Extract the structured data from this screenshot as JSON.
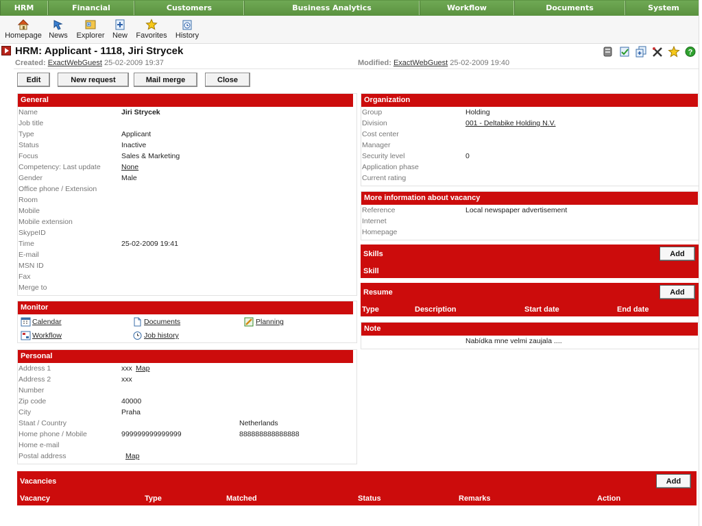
{
  "menu": [
    "HRM",
    "Financial",
    "Customers",
    "Business Analytics",
    "Workflow",
    "Documents",
    "System"
  ],
  "toolbar": [
    {
      "label": "Homepage",
      "icon": "home-icon"
    },
    {
      "label": "News",
      "icon": "news-icon"
    },
    {
      "label": "Explorer",
      "icon": "explorer-icon"
    },
    {
      "label": "New",
      "icon": "new-icon"
    },
    {
      "label": "Favorites",
      "icon": "star-icon"
    },
    {
      "label": "History",
      "icon": "history-icon"
    }
  ],
  "title": "HRM: Applicant - 1118, Jiri Strycek",
  "created": {
    "label": "Created:",
    "user": "ExactWebGuest",
    "date": "25-02-2009 19:37"
  },
  "modified": {
    "label": "Modified:",
    "user": "ExactWebGuest",
    "date": "25-02-2009 19:40"
  },
  "buttons": {
    "edit": "Edit",
    "new_request": "New request",
    "mail_merge": "Mail merge",
    "close": "Close"
  },
  "general": {
    "title": "General",
    "rows": [
      {
        "k": "Name",
        "v": "Jiri Strycek"
      },
      {
        "k": "Job title",
        "v": ""
      },
      {
        "k": "Type",
        "v": "Applicant"
      },
      {
        "k": "Status",
        "v": "Inactive"
      },
      {
        "k": "Focus",
        "v": "Sales & Marketing"
      },
      {
        "k": "Competency: Last update",
        "v": "None"
      },
      {
        "k": "Gender",
        "v": "Male"
      },
      {
        "k": "Office phone / Extension",
        "v": ""
      },
      {
        "k": "Room",
        "v": ""
      },
      {
        "k": "Mobile",
        "v": ""
      },
      {
        "k": "Mobile extension",
        "v": ""
      },
      {
        "k": "SkypeID",
        "v": ""
      },
      {
        "k": "Time",
        "v": "25-02-2009 19:41"
      },
      {
        "k": "E-mail",
        "v": ""
      },
      {
        "k": "MSN ID",
        "v": ""
      },
      {
        "k": "Fax",
        "v": ""
      },
      {
        "k": "Merge to",
        "v": ""
      }
    ]
  },
  "monitor": {
    "title": "Monitor",
    "items": [
      "Calendar",
      "Documents",
      "Planning",
      "Workflow",
      "Job history"
    ]
  },
  "personal": {
    "title": "Personal",
    "address1": "Address 1",
    "address1_v": "xxx",
    "map": "Map",
    "address2": "Address 2",
    "address2_v": "xxx",
    "number": "Number",
    "zip": "Zip code",
    "zip_v": "40000",
    "city": "City",
    "city_v": "Praha",
    "staat": "Staat / Country",
    "country_v": "Netherlands",
    "home_phone": "Home phone / Mobile",
    "home_phone_v": "999999999999999",
    "mobile_v": "888888888888888",
    "home_email": "Home e-mail",
    "postal": "Postal address",
    "postal_map": "Map"
  },
  "organization": {
    "title": "Organization",
    "rows": [
      {
        "k": "Group",
        "v": "Holding"
      },
      {
        "k": "Division",
        "v": "001 - Deltabike Holding N.V."
      },
      {
        "k": "Cost center",
        "v": ""
      },
      {
        "k": "Manager",
        "v": ""
      },
      {
        "k": "Security level",
        "v": "0"
      },
      {
        "k": "Application phase",
        "v": ""
      },
      {
        "k": "Current rating",
        "v": ""
      }
    ]
  },
  "vacancy_info": {
    "title": "More information about vacancy",
    "rows": [
      {
        "k": "Reference",
        "v": "Local newspaper advertisement"
      },
      {
        "k": "Internet",
        "v": ""
      },
      {
        "k": "Homepage",
        "v": ""
      }
    ]
  },
  "skills": {
    "title": "Skills",
    "add": "Add",
    "col": "Skill"
  },
  "resume": {
    "title": "Resume",
    "add": "Add",
    "cols": [
      "Type",
      "Description",
      "Start date",
      "End date"
    ]
  },
  "note": {
    "title": "Note",
    "text": "Nabídka mne velmi zaujala ...."
  },
  "vacancies": {
    "title": "Vacancies",
    "add": "Add",
    "cols": [
      "Vacancy",
      "Type",
      "Matched",
      "Status",
      "Remarks",
      "Action"
    ]
  }
}
